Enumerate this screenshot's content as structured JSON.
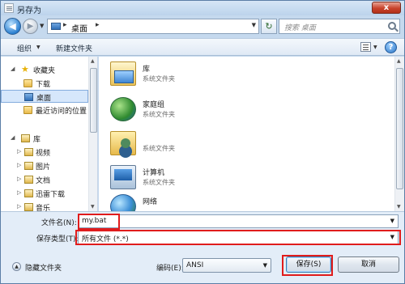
{
  "window": {
    "title": "另存为",
    "close_label": "x"
  },
  "address": {
    "crumb": "桌面",
    "separator": "▸"
  },
  "search": {
    "placeholder": "搜索 桌面"
  },
  "toolbar": {
    "organize_label": "组织",
    "new_folder_label": "新建文件夹"
  },
  "sidebar": {
    "favorites_label": "收藏夹",
    "items": [
      {
        "label": "下载",
        "icon": "download-folder-icon"
      },
      {
        "label": "桌面",
        "icon": "desktop-icon",
        "selected": true
      },
      {
        "label": "最近访问的位置",
        "icon": "recent-places-icon"
      }
    ],
    "library_label": "库",
    "library_items": [
      {
        "label": "视频",
        "icon": "video-library-icon"
      },
      {
        "label": "图片",
        "icon": "pictures-library-icon"
      },
      {
        "label": "文档",
        "icon": "documents-library-icon"
      },
      {
        "label": "迅雷下载",
        "icon": "xunlei-download-icon"
      },
      {
        "label": "音乐",
        "icon": "music-library-icon"
      }
    ]
  },
  "files": [
    {
      "name": "库",
      "type": "系统文件夹",
      "icon": "library-icon"
    },
    {
      "name": "家庭组",
      "type": "系统文件夹",
      "icon": "homegroup-icon"
    },
    {
      "name": "",
      "type": "系统文件夹",
      "icon": "user-folder-icon"
    },
    {
      "name": "计算机",
      "type": "系统文件夹",
      "icon": "computer-icon"
    },
    {
      "name": "网络",
      "type": "",
      "icon": "network-icon"
    }
  ],
  "form": {
    "filename_label": "文件名(N):",
    "filename_value": "my.bat",
    "filetype_label": "保存类型(T):",
    "filetype_value": "所有文件 (*.*)",
    "hide_folders_label": "隐藏文件夹",
    "encoding_label": "编码(E):",
    "encoding_value": "ANSI",
    "save_label": "保存(S)",
    "cancel_label": "取消"
  },
  "colors": {
    "highlight_red": "#e01c1c",
    "selection_blue": "#d6e7fb",
    "chrome_blue": "#c5d9ee"
  }
}
